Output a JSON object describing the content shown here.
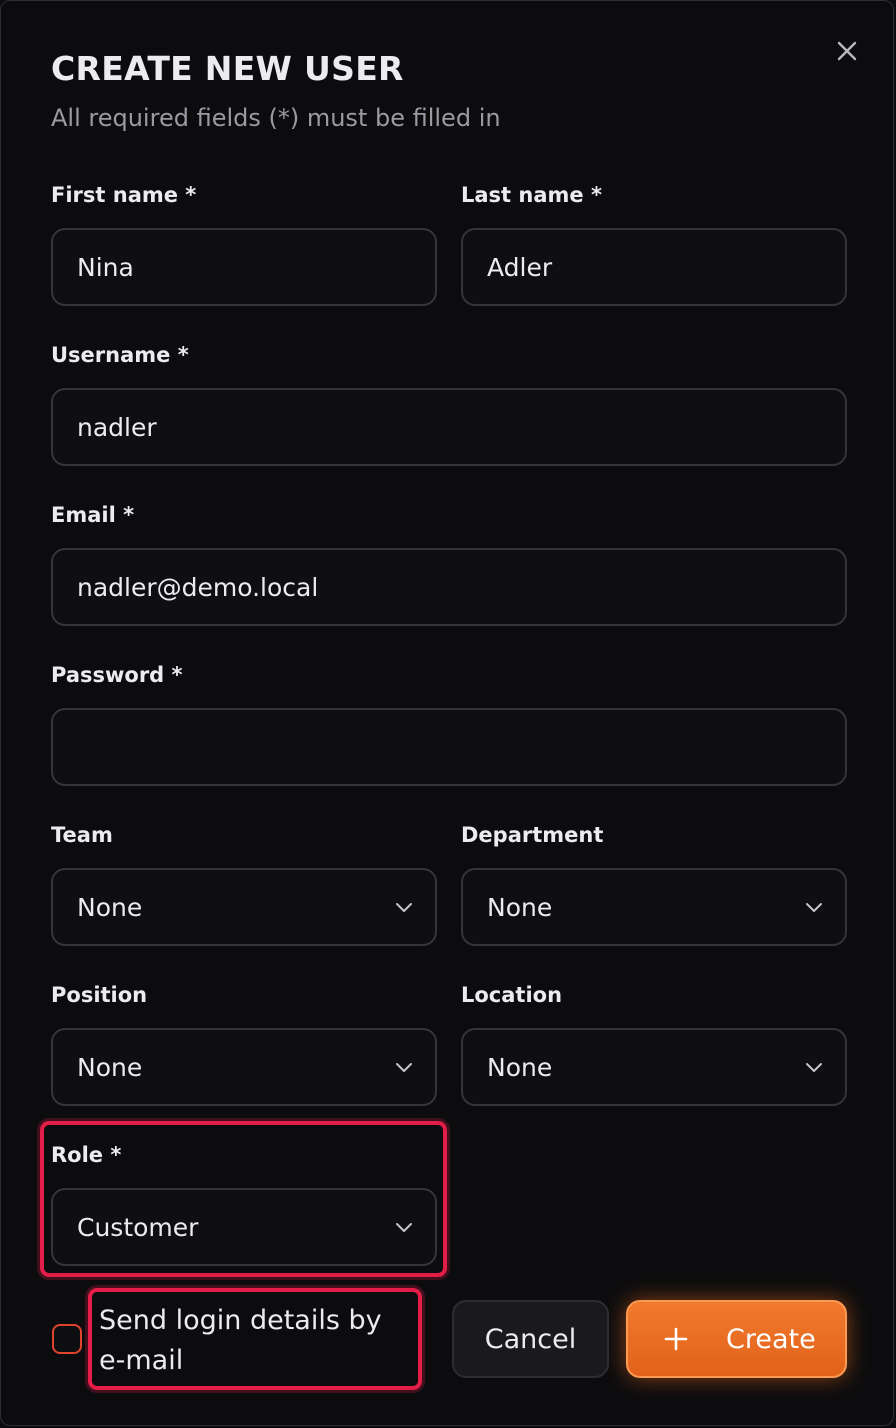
{
  "dialog": {
    "title": "CREATE NEW USER",
    "subtitle": "All required fields (*) must be filled in"
  },
  "fields": {
    "first_name": {
      "label": "First name *",
      "value": "Nina"
    },
    "last_name": {
      "label": "Last name *",
      "value": "Adler"
    },
    "username": {
      "label": "Username *",
      "value": "nadler"
    },
    "email": {
      "label": "Email *",
      "value": "nadler@demo.local"
    },
    "password": {
      "label": "Password *",
      "value": ""
    },
    "team": {
      "label": "Team",
      "value": "None"
    },
    "department": {
      "label": "Department",
      "value": "None"
    },
    "position": {
      "label": "Position",
      "value": "None"
    },
    "location": {
      "label": "Location",
      "value": "None"
    },
    "role": {
      "label": "Role *",
      "value": "Customer"
    }
  },
  "send_login": {
    "label": "Send login details by e-mail",
    "checked": false
  },
  "actions": {
    "cancel_label": "Cancel",
    "create_label": "Create"
  },
  "icons": {
    "close": "close-icon",
    "chevron": "chevron-down-icon",
    "plus": "plus-icon"
  },
  "colors": {
    "background": "#0c0c0e",
    "accent": "#f07a2e",
    "highlight": "#e11d48",
    "checkbox_border": "#e0442d"
  }
}
